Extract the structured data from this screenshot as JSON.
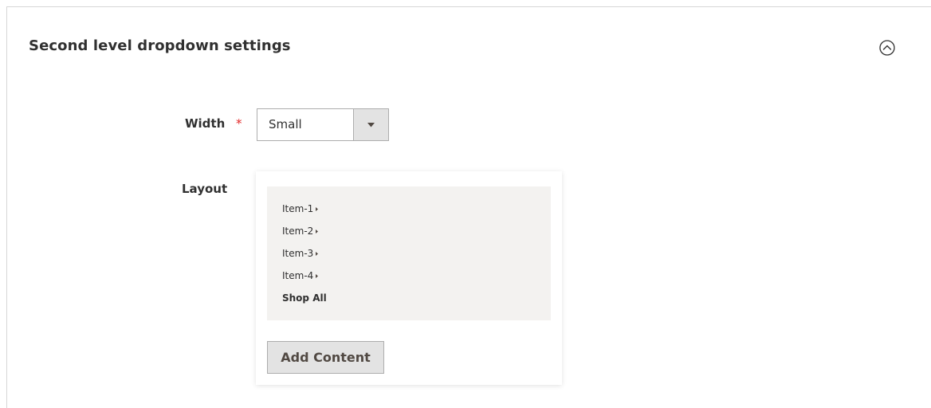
{
  "section": {
    "title": "Second level dropdown settings",
    "collapse_icon": "chevron-up-circle-icon"
  },
  "width_field": {
    "label": "Width",
    "required_marker": "*",
    "value": "Small",
    "dropdown_icon": "triangle-down-icon"
  },
  "layout_field": {
    "label": "Layout",
    "preview_items": [
      {
        "label": "Item-1",
        "icon": "caret-right-icon"
      },
      {
        "label": "Item-2",
        "icon": "caret-right-icon"
      },
      {
        "label": "Item-3",
        "icon": "caret-right-icon"
      },
      {
        "label": "Item-4",
        "icon": "caret-right-icon"
      }
    ],
    "shop_all_label": "Shop All",
    "add_content_label": "Add Content"
  },
  "colors": {
    "required": "#e22626",
    "button_bg": "#e3e3e3",
    "preview_bg": "#f3f2f0",
    "border": "#adadad"
  }
}
